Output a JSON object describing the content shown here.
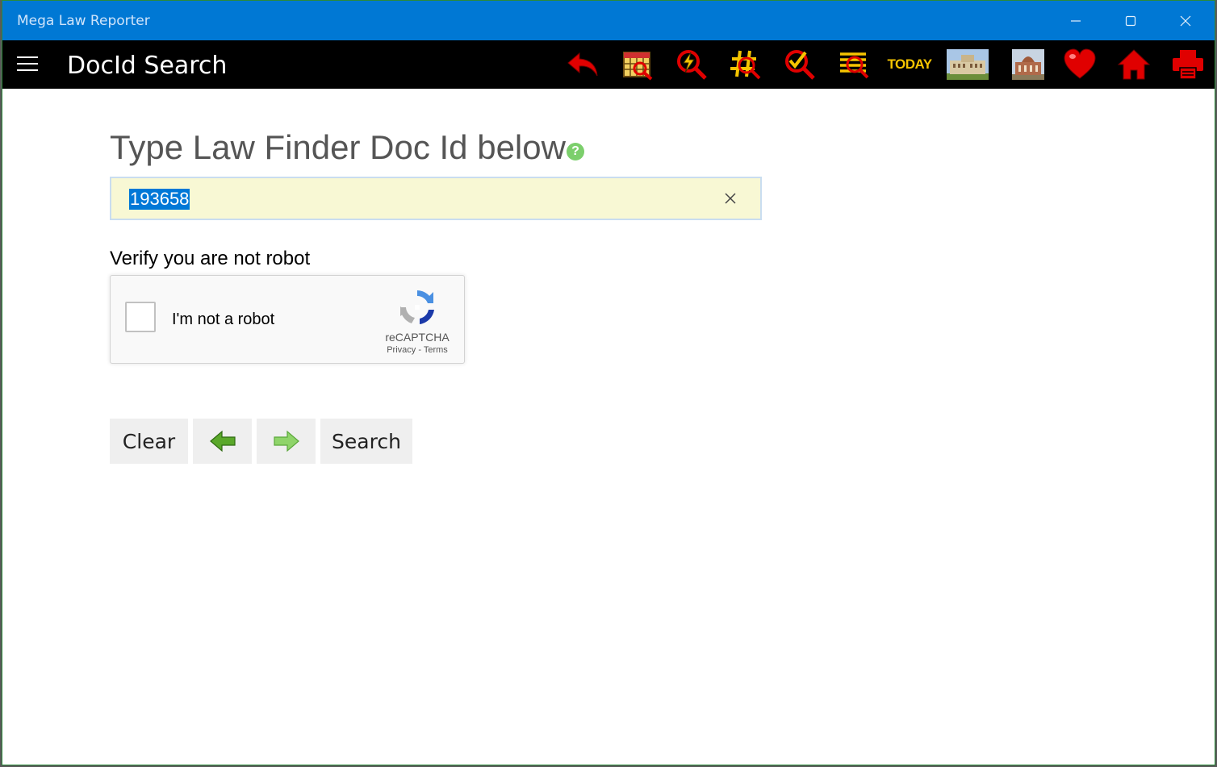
{
  "window": {
    "title": "Mega Law Reporter",
    "accent_color": "#0078d4",
    "controls": [
      "minimize-icon",
      "maximize-icon",
      "close-icon"
    ]
  },
  "appbar": {
    "title": "DocId Search",
    "tools": [
      {
        "name": "back-arrow-icon"
      },
      {
        "name": "calendar-search-icon"
      },
      {
        "name": "flash-search-icon"
      },
      {
        "name": "hashtag-search-icon"
      },
      {
        "name": "check-search-icon"
      },
      {
        "name": "list-search-icon"
      },
      {
        "name": "today-button",
        "label": "TODAY"
      },
      {
        "name": "high-court-building-icon"
      },
      {
        "name": "supreme-court-building-icon"
      },
      {
        "name": "heart-favorites-icon"
      },
      {
        "name": "home-icon"
      },
      {
        "name": "print-icon"
      }
    ]
  },
  "main": {
    "heading": "Type Law Finder Doc Id below",
    "help_icon": "?",
    "docid_value": "193658",
    "verify_label": "Verify you are not robot",
    "captcha": {
      "label": "I'm not a robot",
      "brand": "reCAPTCHA",
      "privacy": "Privacy",
      "separator": " - ",
      "terms": "Terms",
      "checked": false
    },
    "buttons": {
      "clear": "Clear",
      "search": "Search"
    }
  }
}
